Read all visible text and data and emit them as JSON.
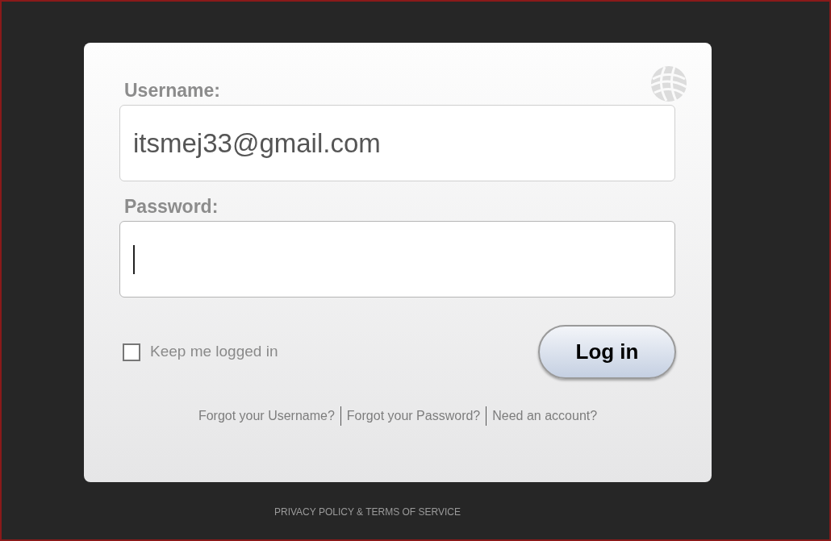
{
  "login_form": {
    "fields": [
      {
        "label": "Username:",
        "value": "itsmej33@gmail.com",
        "focused": false
      },
      {
        "label": "Password:",
        "focused": true
      }
    ],
    "remember": {
      "label": "Keep me logged in",
      "checked": false
    },
    "submit": "Log in",
    "links": [
      "Forgot your Username?",
      "Forgot your Password?",
      "Need an account?"
    ]
  },
  "footer": "PRIVACY POLICY & TERMS OF SERVICE"
}
